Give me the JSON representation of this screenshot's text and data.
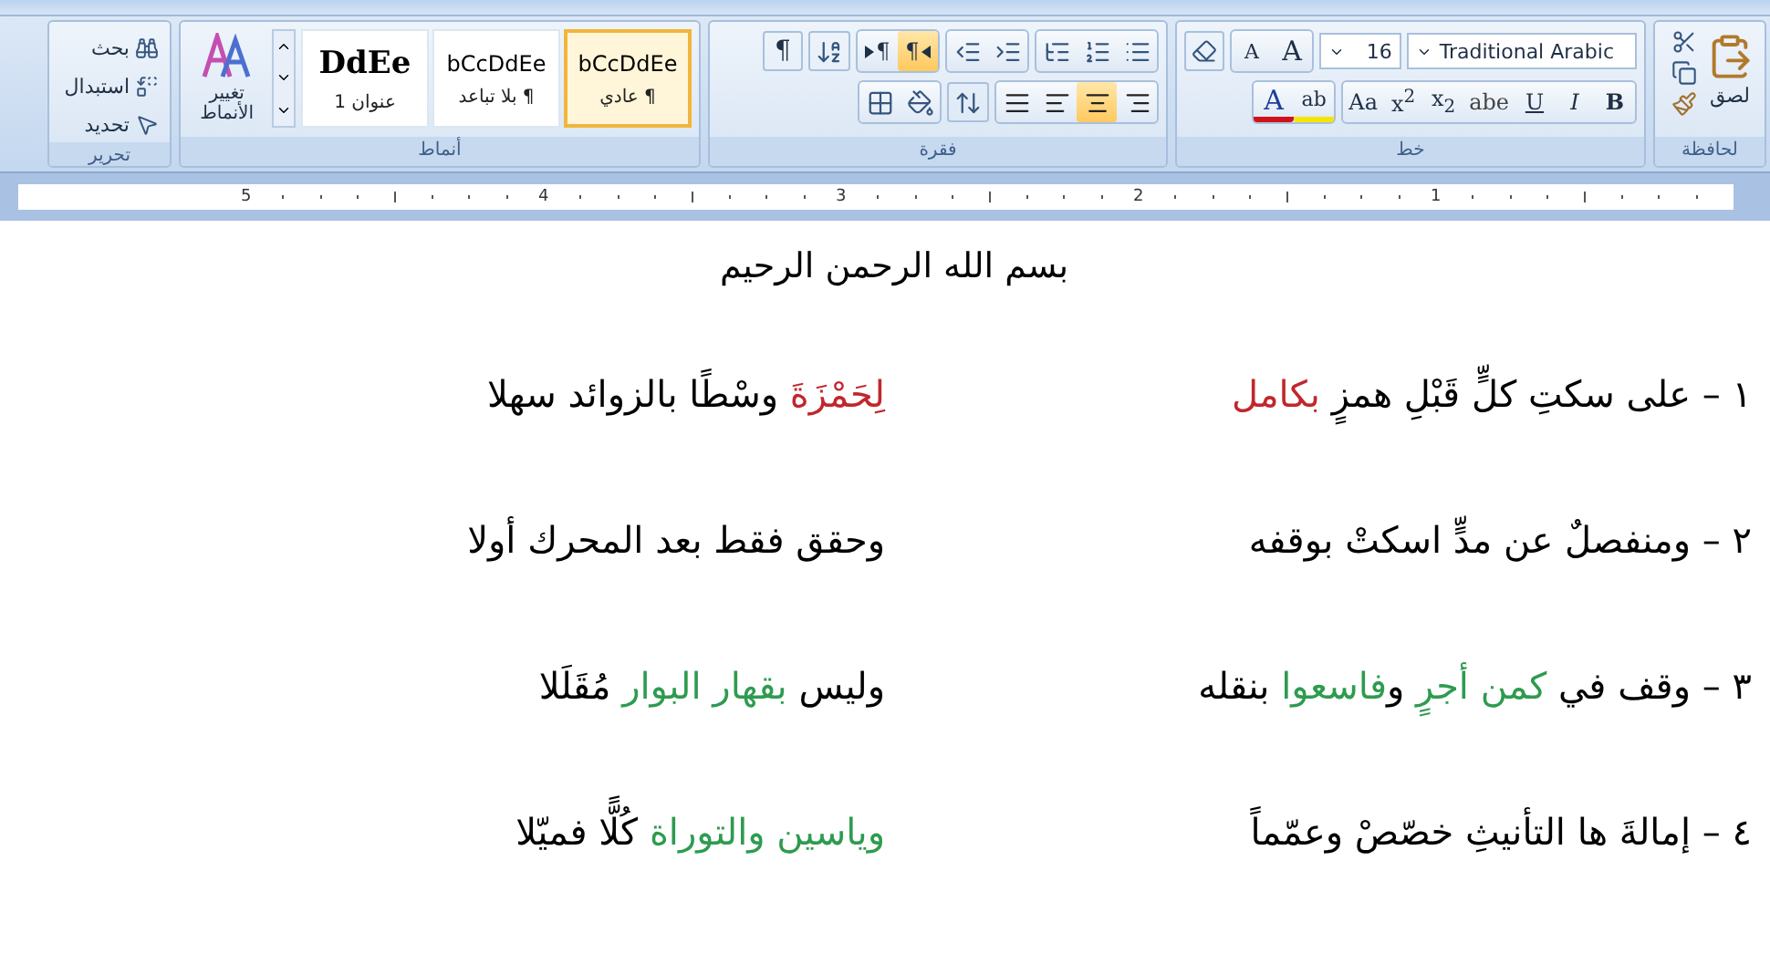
{
  "ribbon": {
    "clipboard": {
      "label": "لحافظة",
      "paste": "لصق"
    },
    "font": {
      "label": "خط",
      "font_name": "Traditional Arabic",
      "font_size": "16",
      "grow": "A",
      "shrink": "A",
      "color_button": "A",
      "highlight_button": "ab",
      "format_buttons": [
        {
          "label": "B",
          "kind": "bold"
        },
        {
          "label": "I",
          "kind": "italic"
        },
        {
          "label": "U",
          "kind": "underline"
        },
        {
          "label": "abe",
          "kind": "strike"
        },
        {
          "label": "x$_{2}$",
          "kind": "plain"
        },
        {
          "label": "x$^{2}$",
          "kind": "plain"
        },
        {
          "label": "Aa",
          "kind": "plain"
        }
      ]
    },
    "paragraph": {
      "label": "فقرة",
      "show_marks": "¶",
      "direction_buttons": [
        {
          "label": "¶",
          "selected": true
        },
        {
          "label": "¶",
          "selected": false
        }
      ],
      "alignments": [
        {
          "kind": "right",
          "selected": false
        },
        {
          "kind": "center",
          "selected": true
        },
        {
          "kind": "left",
          "selected": false
        },
        {
          "kind": "justify",
          "selected": false
        }
      ]
    },
    "styles": {
      "label": "أنماط",
      "change_styles": "تغيير الأنماط",
      "items": [
        {
          "preview": "bCcDdEe",
          "name": "¶ عادي",
          "kind": "body",
          "selected": true
        },
        {
          "preview": "bCcDdEe",
          "name": "¶ بلا تباعد",
          "kind": "body",
          "selected": false
        },
        {
          "preview": "DdEe",
          "name": "عنوان 1",
          "kind": "heading",
          "selected": false
        }
      ]
    },
    "editing": {
      "label": "تحرير",
      "find": "بحث",
      "replace": "استبدال",
      "select": "تحديد"
    }
  },
  "ruler": {
    "numbers": [
      "1",
      "2",
      "3",
      "4",
      "5"
    ]
  },
  "document": {
    "title": "بسم الله الرحمن الرحيم",
    "verses": [
      {
        "right": [
          {
            "text": "١ – على سكتِ كلٍّ قَبْلِ همزٍ ",
            "color": "#000000"
          },
          {
            "text": "بكامل",
            "color": "#c0272d"
          }
        ],
        "left": [
          {
            "text": "لِحَمْزَةَ",
            "color": "#c0272d"
          },
          {
            "text": " وسْطًا بالزوائد سهلا",
            "color": "#000000"
          }
        ]
      },
      {
        "right": [
          {
            "text": "٢ – ومنفصلٌ عن مدٍّ اسكتْ بوقفه",
            "color": "#000000"
          }
        ],
        "left": [
          {
            "text": "وحقق فقط بعد المحرك أولا",
            "color": "#000000"
          }
        ]
      },
      {
        "right": [
          {
            "text": "٣ – وقف في ",
            "color": "#000000"
          },
          {
            "text": "كمن أجرٍ",
            "color": "#2e9b4f"
          },
          {
            "text": " و",
            "color": "#000000"
          },
          {
            "text": "فاسعوا",
            "color": "#2e9b4f"
          },
          {
            "text": " بنقله",
            "color": "#000000"
          }
        ],
        "left": [
          {
            "text": "وليس ",
            "color": "#000000"
          },
          {
            "text": "بقهار البوار",
            "color": "#2e9b4f"
          },
          {
            "text": " مُقَلَلا",
            "color": "#000000"
          }
        ]
      },
      {
        "right": [
          {
            "text": "٤ – إمالةَ ها التأنيثِ خصّصْ وعمّماً",
            "color": "#000000"
          }
        ],
        "left": [
          {
            "text": "وياسين والتوراة",
            "color": "#2e9b4f"
          },
          {
            "text": " كُلًّا فميّلا",
            "color": "#000000"
          }
        ]
      }
    ]
  }
}
